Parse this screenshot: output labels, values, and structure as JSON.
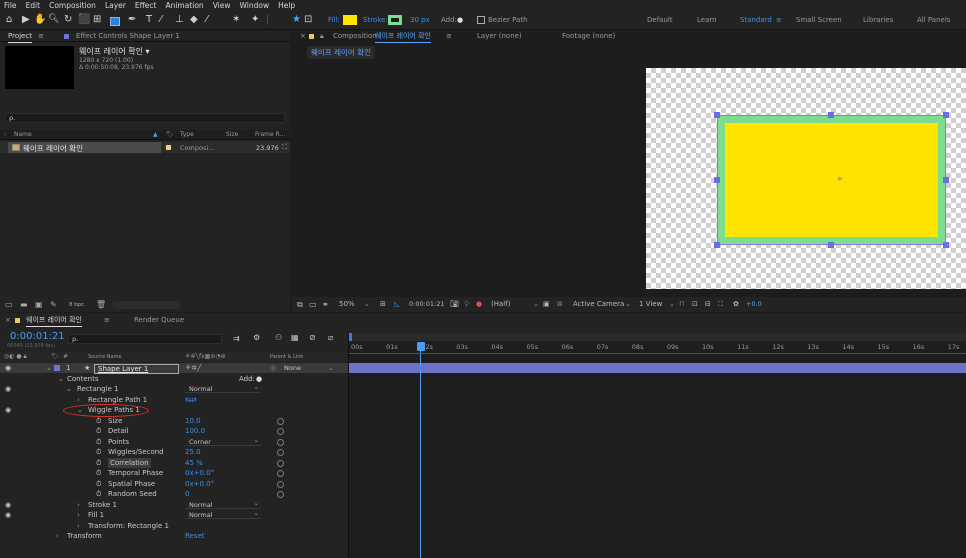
{
  "menu": [
    "File",
    "Edit",
    "Composition",
    "Layer",
    "Effect",
    "Animation",
    "View",
    "Window",
    "Help"
  ],
  "toolbar": {
    "fill_label": "Fill:",
    "stroke_label": "Stroke:",
    "stroke_width": "30 px",
    "add_label": "Add:",
    "bezier_label": "Bezier Path",
    "fill_color": "#ffe400",
    "stroke_color": "#7ddc8e",
    "workspaces": [
      "Default",
      "Learn",
      "Standard",
      "Small Screen",
      "Libraries",
      "All Panels"
    ],
    "active_workspace": "Standard"
  },
  "project_panel": {
    "tab_label": "Project",
    "effect_controls_label": "Effect Controls Shape Layer 1",
    "comp_name": "웨이프 레이어 확인 ▾",
    "comp_size": "1280 x 720 (1.00)",
    "comp_duration": "Δ 0:00:50:08, 23.976 fps",
    "search_placeholder": "ρ.",
    "columns": [
      "Name",
      "Type",
      "Size",
      "Frame R..."
    ],
    "item": {
      "name": "웨이프 레이어 확인",
      "type": "Composi...",
      "frame_rate": "23.976"
    },
    "bpc": "8 bpc"
  },
  "comp_panel": {
    "composition_label": "Composition",
    "comp_tab": "웨이프 레이어 확인",
    "layer_tab": "Layer (none)",
    "footage_tab": "Footage (none)",
    "breadcrumb": "웨이프 레이어 확인",
    "zoom": "50%",
    "timecode": "0:00:01:21",
    "resolution": "(Half)",
    "camera": "Active Camera",
    "views": "1 View",
    "exposure": "+0.0"
  },
  "timeline": {
    "tab_label": "웨이프 레이어 확인",
    "render_queue": "Render Queue",
    "current_time": "0:00:01:21",
    "frame_info": "00045 (23.976 fps)",
    "search_placeholder": "ρ.",
    "col_source": "Source Name",
    "col_parent": "Parent & Link",
    "layer_num": "1",
    "layer_name": "Shape Layer 1",
    "parent_value": "None",
    "contents_label": "Contents",
    "add_label": "Add:",
    "ruler": [
      "00s",
      "01s",
      "02s",
      "03s",
      "04s",
      "05s",
      "06s",
      "07s",
      "08s",
      "09s",
      "10s",
      "11s",
      "12s",
      "13s",
      "14s",
      "15s",
      "16s",
      "17s"
    ],
    "rows": [
      {
        "label": "Rectangle 1",
        "value": "Normal",
        "kind": "dropdown"
      },
      {
        "label": "Rectangle Path 1",
        "value": "",
        "kind": "icon"
      },
      {
        "label": "Wiggle Paths 1",
        "value": "",
        "kind": "plain"
      },
      {
        "label": "Size",
        "value": "10.0",
        "kind": "value"
      },
      {
        "label": "Detail",
        "value": "100.0",
        "kind": "value"
      },
      {
        "label": "Points",
        "value": "Corner",
        "kind": "dropdown"
      },
      {
        "label": "Wiggles/Second",
        "value": "25.0",
        "kind": "value"
      },
      {
        "label": "Correlation",
        "value": "45 %",
        "kind": "value"
      },
      {
        "label": "Temporal Phase",
        "value": "0x+0.0°",
        "kind": "value"
      },
      {
        "label": "Spatial Phase",
        "value": "0x+0.0°",
        "kind": "value"
      },
      {
        "label": "Random Seed",
        "value": "0",
        "kind": "value"
      },
      {
        "label": "Stroke 1",
        "value": "Normal",
        "kind": "dropdown"
      },
      {
        "label": "Fill 1",
        "value": "Normal",
        "kind": "dropdown"
      },
      {
        "label": "Transform: Rectangle 1",
        "value": "",
        "kind": "plain"
      },
      {
        "label": "Transform",
        "value": "Reset",
        "kind": "value"
      }
    ]
  }
}
